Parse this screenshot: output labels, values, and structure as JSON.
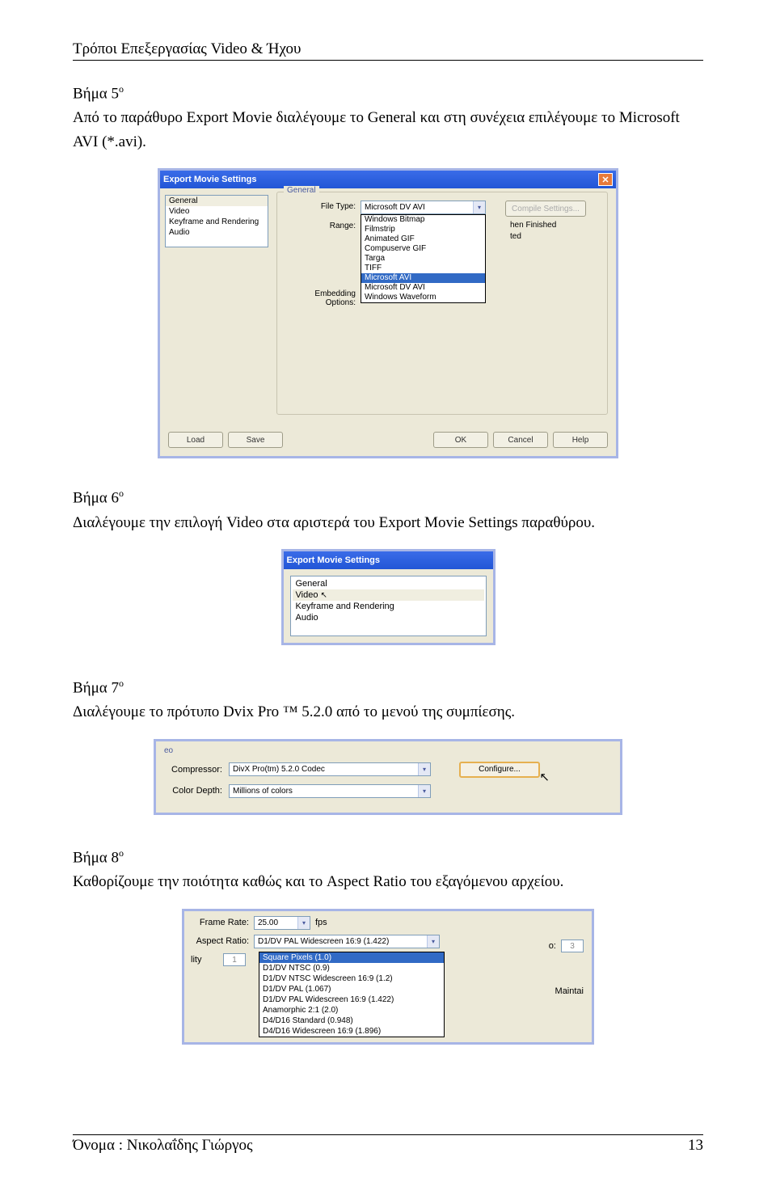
{
  "header": "Τρόποι Επεξεργασίας Video & Ήχου",
  "step5": {
    "heading_prefix": "Βήμα 5",
    "heading_sup": "ο",
    "text": "Από το παράθυρο Export Movie διαλέγουμε το General και στη συνέχεια επιλέγουμε το Microsoft AVI (*.avi)."
  },
  "dlg1": {
    "title": "Export Movie Settings",
    "left_items": [
      "General",
      "Video",
      "Keyframe and Rendering",
      "Audio"
    ],
    "group_label": "General",
    "row_file_type": "File Type:",
    "file_type_value": "Microsoft DV AVI",
    "compile_btn": "Compile Settings...",
    "row_range": "Range:",
    "drop_items": [
      "Windows Bitmap",
      "Filmstrip",
      "Animated GIF",
      "Compuserve GIF",
      "Targa",
      "TIFF"
    ],
    "drop_sel": "Microsoft AVI",
    "drop_after": [
      "Microsoft DV AVI",
      "Windows Waveform"
    ],
    "side1": "hen Finished",
    "side2": "ted",
    "row_embed": "Embedding Options:",
    "btns": [
      "Load",
      "Save",
      "OK",
      "Cancel",
      "Help"
    ]
  },
  "step6": {
    "heading_prefix": "Βήμα 6",
    "heading_sup": "ο",
    "text": "Διαλέγουμε την επιλογή Video στα αριστερά του Export Movie Settings παραθύρου."
  },
  "dlg2": {
    "title": "Export Movie Settings",
    "items": [
      "General",
      "Video",
      "Keyframe and Rendering",
      "Audio"
    ],
    "selected_idx": 1
  },
  "step7": {
    "heading_prefix": "Βήμα 7",
    "heading_sup": "ο",
    "text": "Διαλέγουμε το πρότυπο Dvix Pro ™ 5.2.0 από το μενού της συμπίεσης."
  },
  "dlg3": {
    "corner": "eo",
    "row_compressor": "Compressor:",
    "compressor_value": "DivX Pro(tm) 5.2.0 Codec",
    "configure": "Configure...",
    "row_depth": "Color Depth:",
    "depth_value": "Millions of colors"
  },
  "step8": {
    "heading_prefix": "Βήμα 8",
    "heading_sup": "ο",
    "text": "Καθορίζουμε την ποιότητα καθώς και το Aspect Ratio του εξαγόμενου αρχείου."
  },
  "dlg4": {
    "row_frame_rate": "Frame Rate:",
    "frame_rate_value": "25.00",
    "fps": "fps",
    "row_aspect": "Aspect Ratio:",
    "aspect_value": "D1/DV PAL Widescreen 16:9 (1.422)",
    "lity": "lity",
    "drop_sel": "Square Pixels (1.0)",
    "drop_items": [
      "D1/DV NTSC (0.9)",
      "D1/DV NTSC Widescreen 16:9 (1.2)",
      "D1/DV PAL (1.067)",
      "D1/DV PAL Widescreen 16:9 (1.422)",
      "Anamorphic 2:1 (2.0)",
      "D4/D16 Standard (0.948)",
      "D4/D16 Widescreen 16:9 (1.896)"
    ],
    "side_o": "o:",
    "side_3": "3",
    "side_maintai": "Maintai"
  },
  "footer": {
    "left": "Όνομα : Νικολαΐδης Γιώργος",
    "right": "13"
  }
}
